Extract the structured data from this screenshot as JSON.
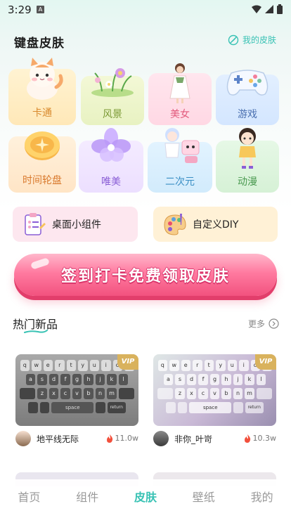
{
  "status_bar": {
    "time": "3:29",
    "notif_letter": "A"
  },
  "header": {
    "title": "键盘皮肤",
    "my_skin_label": "我的皮肤"
  },
  "categories": [
    {
      "label": "卡通",
      "icon": "cat-icon"
    },
    {
      "label": "风景",
      "icon": "flower-icon"
    },
    {
      "label": "美女",
      "icon": "girl-icon"
    },
    {
      "label": "游戏",
      "icon": "gamepad-icon"
    },
    {
      "label": "时间轮盘",
      "icon": "coin-wheel-icon"
    },
    {
      "label": "唯美",
      "icon": "crystal-flower-icon"
    },
    {
      "label": "二次元",
      "icon": "anime-icon"
    },
    {
      "label": "动漫",
      "icon": "doll-icon"
    }
  ],
  "tools": [
    {
      "label": "桌面小组件",
      "icon": "clipboard-icon"
    },
    {
      "label": "自定义DIY",
      "icon": "palette-icon"
    }
  ],
  "banner": {
    "label": "签到打卡免费领取皮肤"
  },
  "hot": {
    "title": "热门新品",
    "more_label": "更多",
    "items": [
      {
        "author": "地平线无际",
        "heat": "11.0w",
        "badge": "VIP"
      },
      {
        "author": "非你_叶岢",
        "heat": "10.3w",
        "badge": "VIP"
      }
    ]
  },
  "keyboard": {
    "row1": [
      "q",
      "w",
      "e",
      "r",
      "t",
      "y",
      "u",
      "i",
      "o",
      "p"
    ],
    "row2": [
      "a",
      "s",
      "d",
      "f",
      "g",
      "h",
      "j",
      "k",
      "l"
    ],
    "row3": [
      "z",
      "x",
      "c",
      "v",
      "b",
      "n",
      "m"
    ],
    "space": "space",
    "return": "return"
  },
  "nav": [
    {
      "label": "首页",
      "active": false
    },
    {
      "label": "组件",
      "active": false
    },
    {
      "label": "皮肤",
      "active": true
    },
    {
      "label": "壁纸",
      "active": false
    },
    {
      "label": "我的",
      "active": false
    }
  ],
  "colors": {
    "accent": "#38c2b4",
    "banner": "#f2527f",
    "vip": "#d9b25d"
  }
}
